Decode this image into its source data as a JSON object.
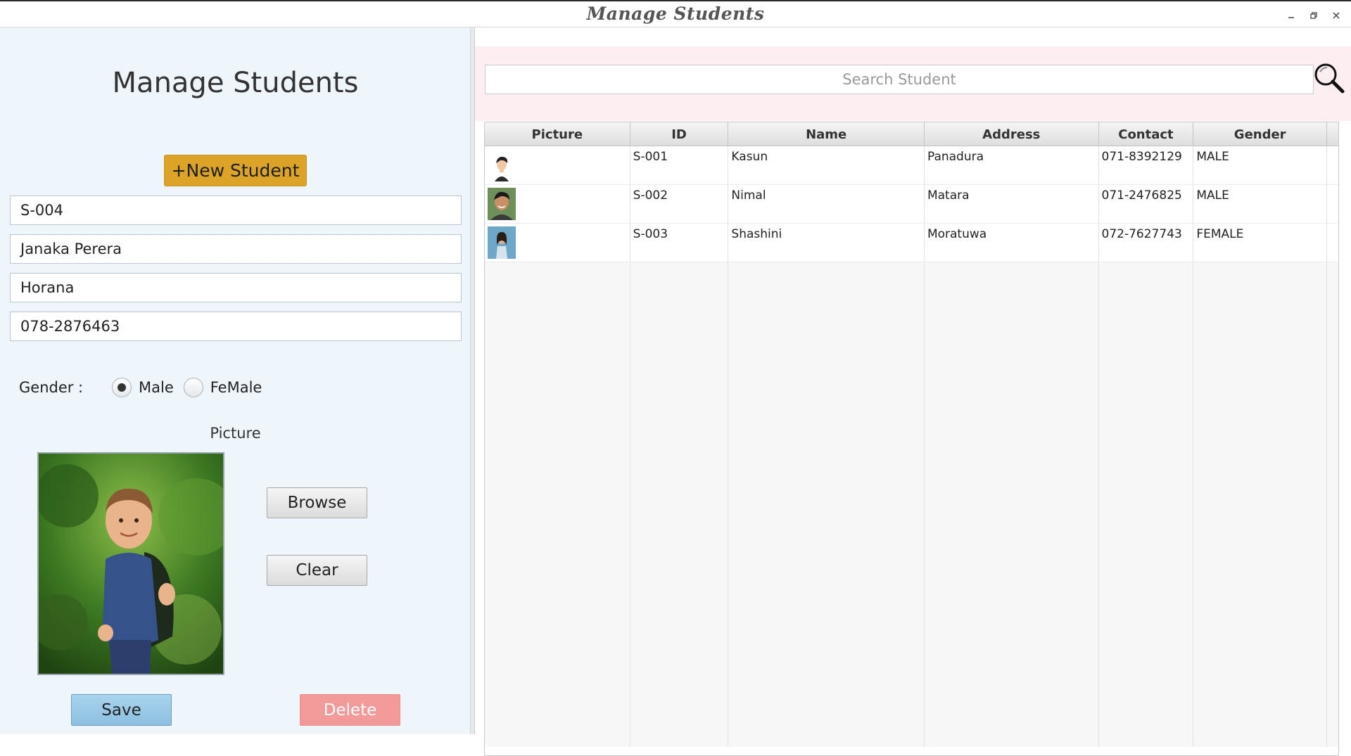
{
  "window": {
    "title": "Manage Students",
    "controls": [
      "minimize-icon",
      "restore-icon",
      "close-icon"
    ]
  },
  "form": {
    "heading": "Manage Students",
    "new_student_label": "+New Student",
    "id_value": "S-004",
    "name_value": "Janaka Perera",
    "address_value": "Horana",
    "contact_value": "078-2876463",
    "gender_label": "Gender :",
    "gender_options": [
      "Male",
      "FeMale"
    ],
    "gender_selected": "Male",
    "picture_label": "Picture",
    "browse_label": "Browse",
    "clear_label": "Clear",
    "save_label": "Save",
    "delete_label": "Delete"
  },
  "search": {
    "placeholder": "Search Student"
  },
  "table": {
    "columns": [
      "Picture",
      "ID",
      "Name",
      "Address",
      "Contact",
      "Gender"
    ],
    "rows": [
      {
        "id": "S-001",
        "name": "Kasun",
        "address": "Panadura",
        "contact": "071-8392129",
        "gender": "MALE"
      },
      {
        "id": "S-002",
        "name": "Nimal",
        "address": "Matara",
        "contact": "071-2476825",
        "gender": "MALE"
      },
      {
        "id": "S-003",
        "name": "Shashini",
        "address": "Moratuwa",
        "contact": "072-7627743",
        "gender": "FEMALE"
      }
    ]
  },
  "colors": {
    "new_student_button": "#dba429",
    "save_button": "#9ccae8",
    "delete_button": "#f29a9a",
    "left_panel_bg": "#eef6fc",
    "search_area_bg": "#fdeff1"
  }
}
